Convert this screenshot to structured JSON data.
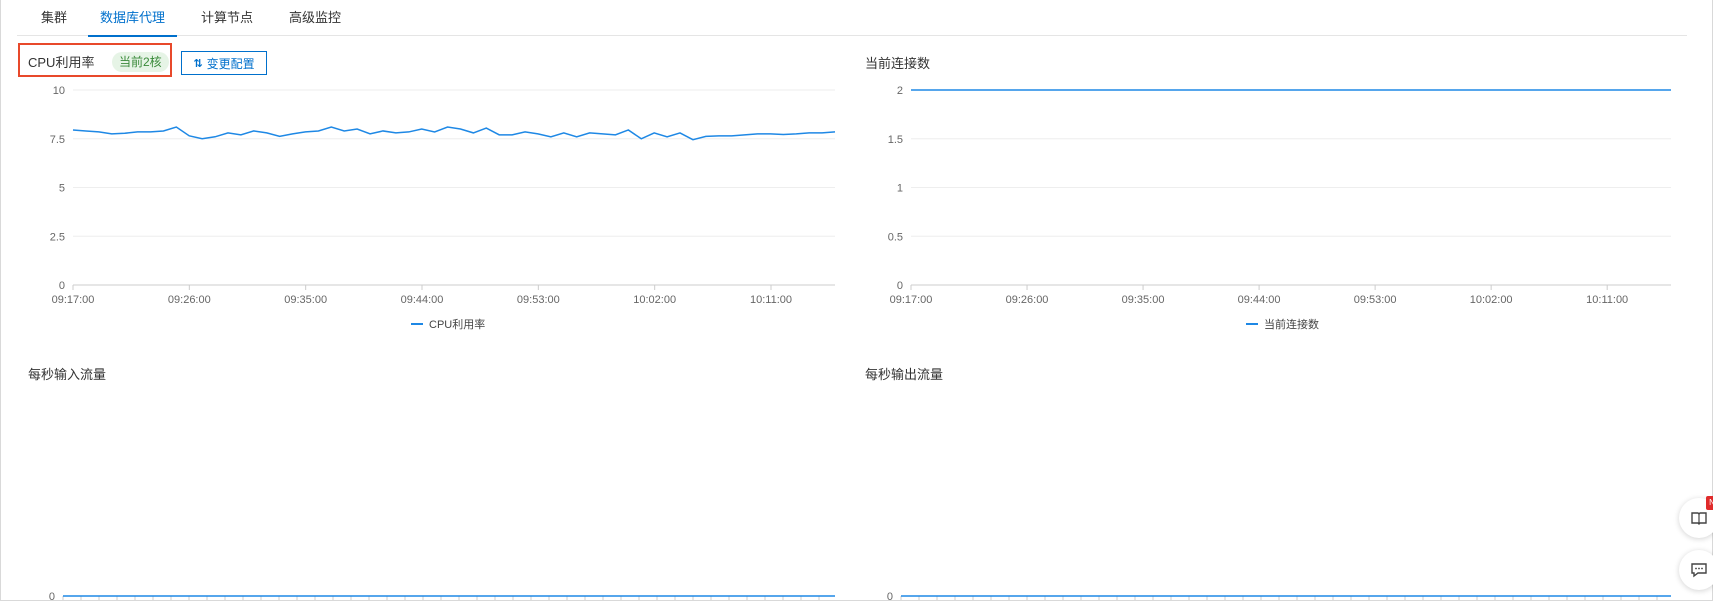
{
  "tabs": [
    {
      "label": "集群",
      "active": false
    },
    {
      "label": "数据库代理",
      "active": true
    },
    {
      "label": "计算节点",
      "active": false
    },
    {
      "label": "高级监控",
      "active": false
    }
  ],
  "cpu_panel": {
    "title": "CPU利用率",
    "badge": "当前2核",
    "change_button": "变更配置"
  },
  "conn_panel": {
    "title": "当前连接数"
  },
  "in_panel": {
    "title": "每秒输入流量"
  },
  "out_panel": {
    "title": "每秒输出流量"
  },
  "side_buttons": {
    "badge": "N",
    "icons": [
      "book-icon",
      "chat-icon"
    ]
  },
  "colors": {
    "accent": "#0070cc",
    "series": "#1e88e5",
    "highlight": "#e8492b"
  },
  "chart_data": [
    {
      "type": "line",
      "ylim": [
        0,
        10
      ],
      "yticks": [
        "0",
        "2.5",
        "5",
        "7.5",
        "10"
      ],
      "xticks": [
        "09:17:00",
        "09:26:00",
        "09:35:00",
        "09:44:00",
        "09:53:00",
        "10:02:00",
        "10:11:00"
      ],
      "series": [
        {
          "name": "CPU利用率",
          "values": [
            7.95,
            7.9,
            7.85,
            7.75,
            7.78,
            7.85,
            7.85,
            7.9,
            8.1,
            7.65,
            7.5,
            7.6,
            7.8,
            7.7,
            7.9,
            7.8,
            7.62,
            7.75,
            7.85,
            7.9,
            8.1,
            7.9,
            8.0,
            7.75,
            7.9,
            7.8,
            7.85,
            8.0,
            7.85,
            8.1,
            8.0,
            7.8,
            8.05,
            7.7,
            7.7,
            7.85,
            7.75,
            7.6,
            7.8,
            7.6,
            7.8,
            7.75,
            7.7,
            7.95,
            7.5,
            7.8,
            7.6,
            7.8,
            7.45,
            7.62,
            7.65,
            7.65,
            7.7,
            7.75,
            7.75,
            7.72,
            7.75,
            7.8,
            7.8,
            7.85
          ]
        }
      ]
    },
    {
      "type": "line",
      "ylim": [
        0,
        2
      ],
      "yticks": [
        "0",
        "0.5",
        "1",
        "1.5",
        "2"
      ],
      "xticks": [
        "09:17:00",
        "09:26:00",
        "09:35:00",
        "09:44:00",
        "09:53:00",
        "10:02:00",
        "10:11:00"
      ],
      "series": [
        {
          "name": "当前连接数",
          "values": [
            2,
            2
          ]
        }
      ]
    },
    {
      "type": "line",
      "ylim": [
        0,
        1
      ],
      "yticks": [
        "0"
      ],
      "series": [
        {
          "values": [
            0,
            0
          ]
        }
      ]
    },
    {
      "type": "line",
      "ylim": [
        0,
        1
      ],
      "yticks": [
        "0"
      ],
      "series": [
        {
          "values": [
            0,
            0
          ]
        }
      ]
    }
  ]
}
